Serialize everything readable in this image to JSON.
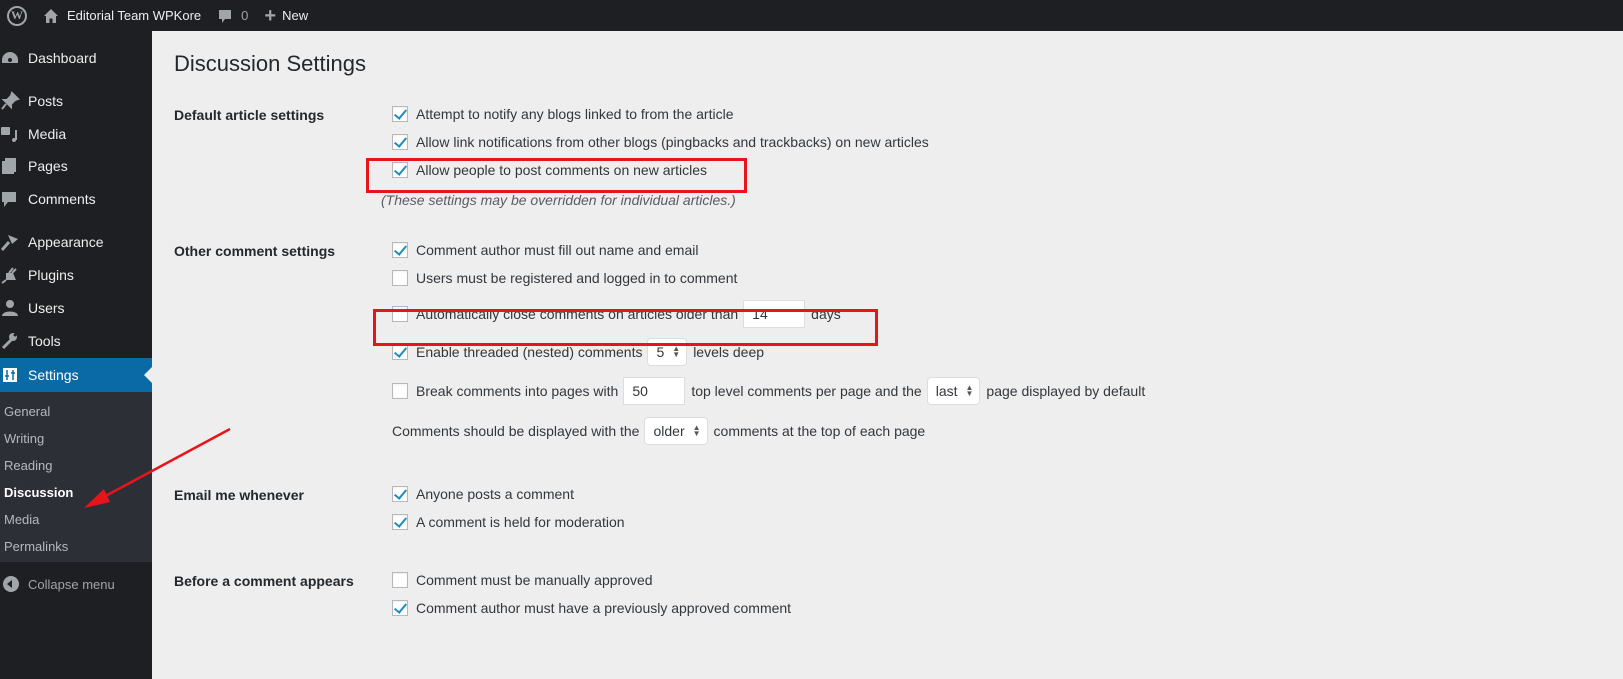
{
  "adminbar": {
    "site_name": "Editorial Team WPKore",
    "comments_count": "0",
    "new_label": "New"
  },
  "sidebar": {
    "items": [
      {
        "label": "Dashboard",
        "icon": "dashboard-icon"
      },
      {
        "label": "Posts",
        "icon": "pin-icon"
      },
      {
        "label": "Media",
        "icon": "media-icon"
      },
      {
        "label": "Pages",
        "icon": "pages-icon"
      },
      {
        "label": "Comments",
        "icon": "comment-icon"
      },
      {
        "label": "Appearance",
        "icon": "paintbrush-icon"
      },
      {
        "label": "Plugins",
        "icon": "plug-icon"
      },
      {
        "label": "Users",
        "icon": "user-icon"
      },
      {
        "label": "Tools",
        "icon": "wrench-icon"
      },
      {
        "label": "Settings",
        "icon": "settings-icon"
      }
    ],
    "submenu": [
      "General",
      "Writing",
      "Reading",
      "Discussion",
      "Media",
      "Permalinks"
    ],
    "current_submenu": "Discussion",
    "collapse_label": "Collapse menu"
  },
  "page": {
    "title": "Discussion Settings",
    "sections": {
      "default_article": {
        "label": "Default article settings",
        "options": [
          {
            "label": "Attempt to notify any blogs linked to from the article",
            "checked": true
          },
          {
            "label": "Allow link notifications from other blogs (pingbacks and trackbacks) on new articles",
            "checked": true
          },
          {
            "label": "Allow people to post comments on new articles",
            "checked": true
          }
        ],
        "note": "(These settings may be overridden for individual articles.)"
      },
      "other_comment": {
        "label": "Other comment settings",
        "name_email": {
          "label": "Comment author must fill out name and email",
          "checked": true
        },
        "registered": {
          "label": "Users must be registered and logged in to comment",
          "checked": false
        },
        "auto_close": {
          "label": "Automatically close comments on articles older than",
          "checked": false,
          "value": "14",
          "suffix": "days"
        },
        "threaded": {
          "label": "Enable threaded (nested) comments",
          "checked": true,
          "value": "5",
          "suffix": "levels deep"
        },
        "paged": {
          "label": "Break comments into pages with",
          "checked": false,
          "value": "50",
          "middle": "top level comments per page and the",
          "select": "last",
          "suffix": "page displayed by default"
        },
        "order": {
          "prefix": "Comments should be displayed with the",
          "select": "older",
          "suffix": "comments at the top of each page"
        }
      },
      "email": {
        "label": "Email me whenever",
        "options": [
          {
            "label": "Anyone posts a comment",
            "checked": true
          },
          {
            "label": "A comment is held for moderation",
            "checked": true
          }
        ]
      },
      "before_appears": {
        "label": "Before a comment appears",
        "options": [
          {
            "label": "Comment must be manually approved",
            "checked": false
          },
          {
            "label": "Comment author must have a previously approved comment",
            "checked": true
          }
        ]
      }
    }
  },
  "annotations": {
    "highlight_color": "#e8141b"
  }
}
